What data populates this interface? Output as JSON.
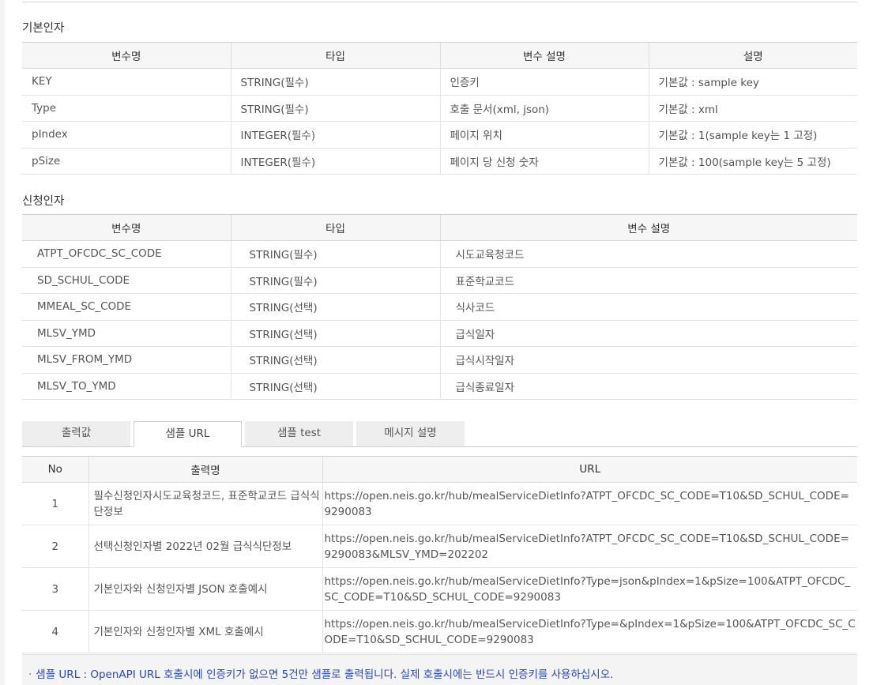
{
  "basic_title": "기본인자",
  "basic_table": {
    "headers": [
      "변수명",
      "타입",
      "변수 설명",
      "설명"
    ],
    "rows": [
      [
        "KEY",
        "STRING(필수)",
        "인증키",
        "기본값 : sample key"
      ],
      [
        "Type",
        "STRING(필수)",
        "호출 문서(xml, json)",
        "기본값 : xml"
      ],
      [
        "pIndex",
        "INTEGER(필수)",
        "페이지 위치",
        "기본값 : 1(sample key는 1 고정)"
      ],
      [
        "pSize",
        "INTEGER(필수)",
        "페이지 당 신청 숫자",
        "기본값 : 100(sample key는 5 고정)"
      ]
    ]
  },
  "request_title": "신청인자",
  "request_table": {
    "headers": [
      "변수명",
      "타입",
      "변수 설명"
    ],
    "rows": [
      [
        "ATPT_OFCDC_SC_CODE",
        "STRING(필수)",
        "시도교육청코드"
      ],
      [
        "SD_SCHUL_CODE",
        "STRING(필수)",
        "표준학교코드"
      ],
      [
        "MMEAL_SC_CODE",
        "STRING(선택)",
        "식사코드"
      ],
      [
        "MLSV_YMD",
        "STRING(선택)",
        "급식일자"
      ],
      [
        "MLSV_FROM_YMD",
        "STRING(선택)",
        "급식시작일자"
      ],
      [
        "MLSV_TO_YMD",
        "STRING(선택)",
        "급식종료일자"
      ]
    ]
  },
  "tabs": [
    {
      "label": "출력값",
      "active": false
    },
    {
      "label": "샘플 URL",
      "active": true
    },
    {
      "label": "샘플 test",
      "active": false
    },
    {
      "label": "메시지 설명",
      "active": false
    }
  ],
  "url_table": {
    "headers": [
      "No",
      "출력명",
      "URL"
    ],
    "rows": [
      [
        "1",
        "필수신청인자시도교육청코드, 표준학교코드 급식식단정보",
        "https://open.neis.go.kr/hub/mealServiceDietInfo?ATPT_OFCDC_SC_CODE=T10&SD_SCHUL_CODE=9290083"
      ],
      [
        "2",
        "선택신청인자별 2022년 02월 급식식단정보",
        "https://open.neis.go.kr/hub/mealServiceDietInfo?ATPT_OFCDC_SC_CODE=T10&SD_SCHUL_CODE=9290083&MLSV_YMD=202202"
      ],
      [
        "3",
        "기본인자와 신청인자별 JSON 호출예시",
        "https://open.neis.go.kr/hub/mealServiceDietInfo?Type=json&pIndex=1&pSize=100&ATPT_OFCDC_SC_CODE=T10&SD_SCHUL_CODE=9290083"
      ],
      [
        "4",
        "기본인자와 신청인자별 XML 호출예시",
        "https://open.neis.go.kr/hub/mealServiceDietInfo?Type=&pIndex=1&pSize=100&ATPT_OFCDC_SC_CODE=T10&SD_SCHUL_CODE=9290083"
      ]
    ]
  },
  "note": {
    "bullet": "·",
    "text": "샘플 URL : OpenAPI URL 호출시에 인증키가 없으면 5건만 샘플로 출력됩니다. 실제 호출시에는 반드시 인증키를 사용하십시오."
  }
}
